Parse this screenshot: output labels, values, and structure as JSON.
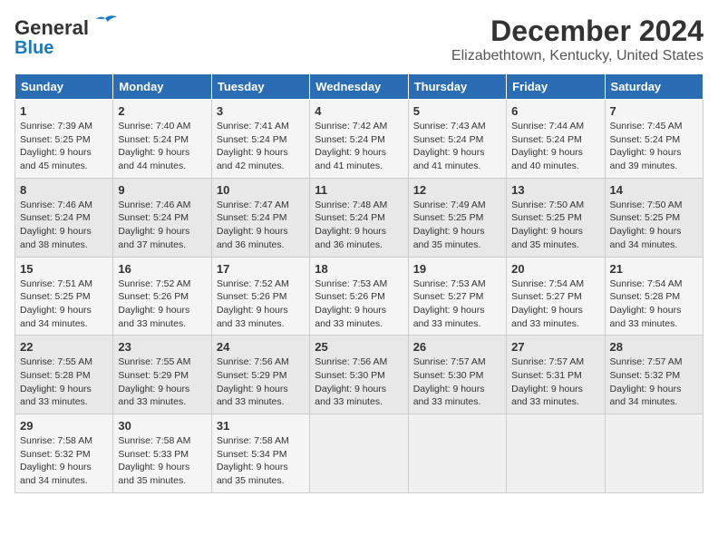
{
  "header": {
    "logo_general": "General",
    "logo_blue": "Blue",
    "title": "December 2024",
    "subtitle": "Elizabethtown, Kentucky, United States"
  },
  "days_of_week": [
    "Sunday",
    "Monday",
    "Tuesday",
    "Wednesday",
    "Thursday",
    "Friday",
    "Saturday"
  ],
  "weeks": [
    [
      {
        "day": "1",
        "sunrise": "Sunrise: 7:39 AM",
        "sunset": "Sunset: 5:25 PM",
        "daylight": "Daylight: 9 hours and 45 minutes."
      },
      {
        "day": "2",
        "sunrise": "Sunrise: 7:40 AM",
        "sunset": "Sunset: 5:24 PM",
        "daylight": "Daylight: 9 hours and 44 minutes."
      },
      {
        "day": "3",
        "sunrise": "Sunrise: 7:41 AM",
        "sunset": "Sunset: 5:24 PM",
        "daylight": "Daylight: 9 hours and 42 minutes."
      },
      {
        "day": "4",
        "sunrise": "Sunrise: 7:42 AM",
        "sunset": "Sunset: 5:24 PM",
        "daylight": "Daylight: 9 hours and 41 minutes."
      },
      {
        "day": "5",
        "sunrise": "Sunrise: 7:43 AM",
        "sunset": "Sunset: 5:24 PM",
        "daylight": "Daylight: 9 hours and 41 minutes."
      },
      {
        "day": "6",
        "sunrise": "Sunrise: 7:44 AM",
        "sunset": "Sunset: 5:24 PM",
        "daylight": "Daylight: 9 hours and 40 minutes."
      },
      {
        "day": "7",
        "sunrise": "Sunrise: 7:45 AM",
        "sunset": "Sunset: 5:24 PM",
        "daylight": "Daylight: 9 hours and 39 minutes."
      }
    ],
    [
      {
        "day": "8",
        "sunrise": "Sunrise: 7:46 AM",
        "sunset": "Sunset: 5:24 PM",
        "daylight": "Daylight: 9 hours and 38 minutes."
      },
      {
        "day": "9",
        "sunrise": "Sunrise: 7:46 AM",
        "sunset": "Sunset: 5:24 PM",
        "daylight": "Daylight: 9 hours and 37 minutes."
      },
      {
        "day": "10",
        "sunrise": "Sunrise: 7:47 AM",
        "sunset": "Sunset: 5:24 PM",
        "daylight": "Daylight: 9 hours and 36 minutes."
      },
      {
        "day": "11",
        "sunrise": "Sunrise: 7:48 AM",
        "sunset": "Sunset: 5:24 PM",
        "daylight": "Daylight: 9 hours and 36 minutes."
      },
      {
        "day": "12",
        "sunrise": "Sunrise: 7:49 AM",
        "sunset": "Sunset: 5:25 PM",
        "daylight": "Daylight: 9 hours and 35 minutes."
      },
      {
        "day": "13",
        "sunrise": "Sunrise: 7:50 AM",
        "sunset": "Sunset: 5:25 PM",
        "daylight": "Daylight: 9 hours and 35 minutes."
      },
      {
        "day": "14",
        "sunrise": "Sunrise: 7:50 AM",
        "sunset": "Sunset: 5:25 PM",
        "daylight": "Daylight: 9 hours and 34 minutes."
      }
    ],
    [
      {
        "day": "15",
        "sunrise": "Sunrise: 7:51 AM",
        "sunset": "Sunset: 5:25 PM",
        "daylight": "Daylight: 9 hours and 34 minutes."
      },
      {
        "day": "16",
        "sunrise": "Sunrise: 7:52 AM",
        "sunset": "Sunset: 5:26 PM",
        "daylight": "Daylight: 9 hours and 33 minutes."
      },
      {
        "day": "17",
        "sunrise": "Sunrise: 7:52 AM",
        "sunset": "Sunset: 5:26 PM",
        "daylight": "Daylight: 9 hours and 33 minutes."
      },
      {
        "day": "18",
        "sunrise": "Sunrise: 7:53 AM",
        "sunset": "Sunset: 5:26 PM",
        "daylight": "Daylight: 9 hours and 33 minutes."
      },
      {
        "day": "19",
        "sunrise": "Sunrise: 7:53 AM",
        "sunset": "Sunset: 5:27 PM",
        "daylight": "Daylight: 9 hours and 33 minutes."
      },
      {
        "day": "20",
        "sunrise": "Sunrise: 7:54 AM",
        "sunset": "Sunset: 5:27 PM",
        "daylight": "Daylight: 9 hours and 33 minutes."
      },
      {
        "day": "21",
        "sunrise": "Sunrise: 7:54 AM",
        "sunset": "Sunset: 5:28 PM",
        "daylight": "Daylight: 9 hours and 33 minutes."
      }
    ],
    [
      {
        "day": "22",
        "sunrise": "Sunrise: 7:55 AM",
        "sunset": "Sunset: 5:28 PM",
        "daylight": "Daylight: 9 hours and 33 minutes."
      },
      {
        "day": "23",
        "sunrise": "Sunrise: 7:55 AM",
        "sunset": "Sunset: 5:29 PM",
        "daylight": "Daylight: 9 hours and 33 minutes."
      },
      {
        "day": "24",
        "sunrise": "Sunrise: 7:56 AM",
        "sunset": "Sunset: 5:29 PM",
        "daylight": "Daylight: 9 hours and 33 minutes."
      },
      {
        "day": "25",
        "sunrise": "Sunrise: 7:56 AM",
        "sunset": "Sunset: 5:30 PM",
        "daylight": "Daylight: 9 hours and 33 minutes."
      },
      {
        "day": "26",
        "sunrise": "Sunrise: 7:57 AM",
        "sunset": "Sunset: 5:30 PM",
        "daylight": "Daylight: 9 hours and 33 minutes."
      },
      {
        "day": "27",
        "sunrise": "Sunrise: 7:57 AM",
        "sunset": "Sunset: 5:31 PM",
        "daylight": "Daylight: 9 hours and 33 minutes."
      },
      {
        "day": "28",
        "sunrise": "Sunrise: 7:57 AM",
        "sunset": "Sunset: 5:32 PM",
        "daylight": "Daylight: 9 hours and 34 minutes."
      }
    ],
    [
      {
        "day": "29",
        "sunrise": "Sunrise: 7:58 AM",
        "sunset": "Sunset: 5:32 PM",
        "daylight": "Daylight: 9 hours and 34 minutes."
      },
      {
        "day": "30",
        "sunrise": "Sunrise: 7:58 AM",
        "sunset": "Sunset: 5:33 PM",
        "daylight": "Daylight: 9 hours and 35 minutes."
      },
      {
        "day": "31",
        "sunrise": "Sunrise: 7:58 AM",
        "sunset": "Sunset: 5:34 PM",
        "daylight": "Daylight: 9 hours and 35 minutes."
      },
      null,
      null,
      null,
      null
    ]
  ]
}
